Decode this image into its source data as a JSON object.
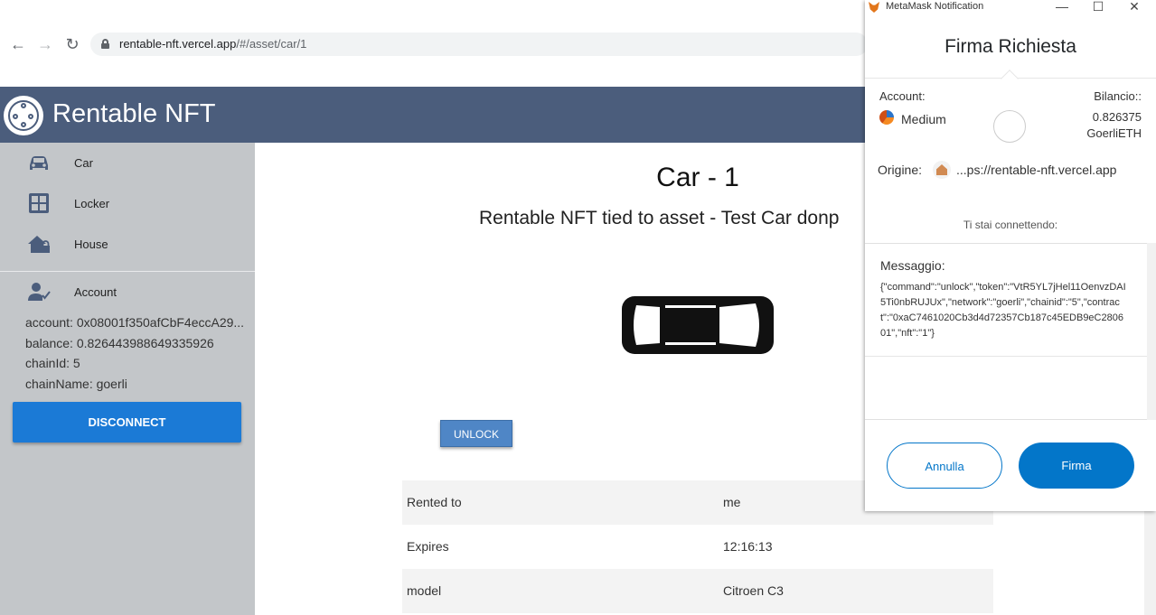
{
  "browser": {
    "back_icon": "←",
    "forward_icon": "→",
    "reload_icon": "↻",
    "url_host": "rentable-nft.vercel.app",
    "url_path": "/#/asset/car/1"
  },
  "app": {
    "title": "Rentable NFT",
    "header_color": "#4b5d7c"
  },
  "sidebar": {
    "items": [
      {
        "label": "Car",
        "icon": "car-icon"
      },
      {
        "label": "Locker",
        "icon": "locker-icon"
      },
      {
        "label": "House",
        "icon": "house-lock-icon"
      }
    ],
    "account": {
      "label": "Account",
      "icon": "account-check-icon",
      "account_line": "account: 0x08001f350afCbF4eccA29...",
      "balance_line": "balance: 0.826443988649335926",
      "chainid_line": "chainId: 5",
      "chainname_line": "chainName: goerli"
    },
    "disconnect_label": "DISCONNECT",
    "accent": "#1b7ad6"
  },
  "main": {
    "title": "Car - 1",
    "subtitle": "Rentable NFT tied to asset - Test Car donp",
    "unlock_label": "UNLOCK",
    "rows": [
      {
        "key": "Rented to",
        "value": "me"
      },
      {
        "key": "Expires",
        "value": "12:16:13"
      },
      {
        "key": "model",
        "value": "Citroen C3"
      }
    ]
  },
  "metamask": {
    "window_title": "MetaMask Notification",
    "minimize": "—",
    "maximize": "☐",
    "close": "✕",
    "heading": "Firma Richiesta",
    "account_label": "Account:",
    "account_name": "Medium",
    "balance_label": "Bilancio::",
    "balance_value": "0.826375",
    "balance_unit": "GoerliETH",
    "origin_label": "Origine:",
    "origin_value": "...ps://rentable-nft.vercel.app",
    "connecting": "Ti stai connettendo:",
    "message_title": "Messaggio:",
    "message_text": "{\"command\":\"unlock\",\"token\":\"VtR5YL7jHel11OenvzDAI5Ti0nbRUJUx\",\"network\":\"goerli\",\"chainid\":\"5\",\"contract\":\"0xaC7461020Cb3d4d72357Cb187c45EDB9eC280601\",\"nft\":\"1\"}",
    "cancel_label": "Annulla",
    "sign_label": "Firma",
    "accent": "#0376c9"
  }
}
